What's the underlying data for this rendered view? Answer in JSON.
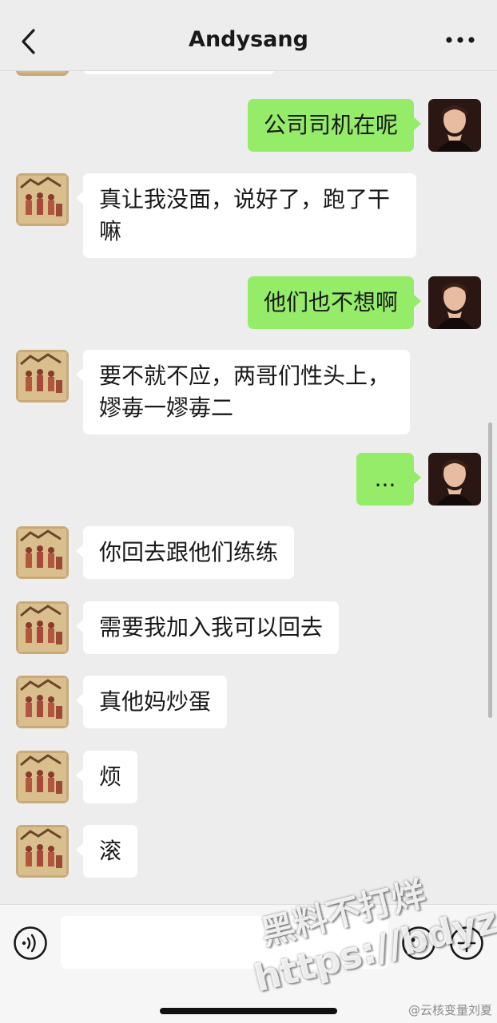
{
  "header": {
    "title": "Andysang",
    "back_icon": "chevron-left-icon",
    "more_icon": "more-dots-icon"
  },
  "messages": [
    {
      "side": "right",
      "text": "公司司机在呢"
    },
    {
      "side": "left",
      "text": "真让我没面，说好了，跑了干嘛"
    },
    {
      "side": "right",
      "text": "他们也不想啊"
    },
    {
      "side": "left",
      "text": "要不就不应，两哥们性头上，嫪毐一嫪毐二"
    },
    {
      "side": "right",
      "text": "..."
    },
    {
      "side": "left",
      "text": "你回去跟他们练练"
    },
    {
      "side": "left",
      "text": "需要我加入我可以回去"
    },
    {
      "side": "left",
      "text": "真他妈炒蛋"
    },
    {
      "side": "left",
      "text": "烦"
    },
    {
      "side": "left",
      "text": "滚"
    }
  ],
  "input": {
    "voice_icon": "voice-icon",
    "emoji_icon": "emoji-icon",
    "plus_icon": "plus-circle-icon",
    "value": ""
  },
  "watermark": {
    "line1": "黑料不打烊",
    "line2": "https://bdyz.co"
  },
  "credit": "@云核变量刘夏",
  "colors": {
    "background": "#ededed",
    "sent_bubble": "#95ec69",
    "received_bubble": "#ffffff"
  }
}
